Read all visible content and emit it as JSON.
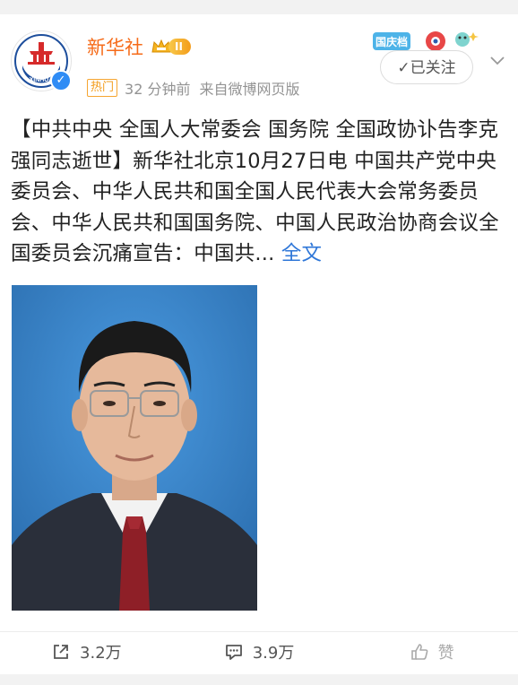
{
  "post": {
    "author": {
      "name": "新华社",
      "level": "II",
      "avatar_text": "XINHUA",
      "verified": true
    },
    "meta": {
      "hot_label": "热门",
      "time": "32 分钟前",
      "source": "来自微博网页版"
    },
    "festival_badge": "国庆档",
    "follow_label": "✓已关注",
    "text": "【中共中央 全国人大常委会 国务院 全国政协讣告李克强同志逝世】新华社北京10月27日电 中国共产党中央委员会、中华人民共和国全国人民代表大会常务委员会、中华人民共和国国务院、中国人民政治协商会议全国委员会沉痛宣告：中国共...",
    "full_text_link": "全文",
    "colors": {
      "username": "#f66b19",
      "link": "#2f77d8",
      "photo_background": "#3d8ccf"
    }
  },
  "actions": {
    "repost_count": "3.2万",
    "comment_count": "3.9万",
    "like_label": "赞"
  }
}
